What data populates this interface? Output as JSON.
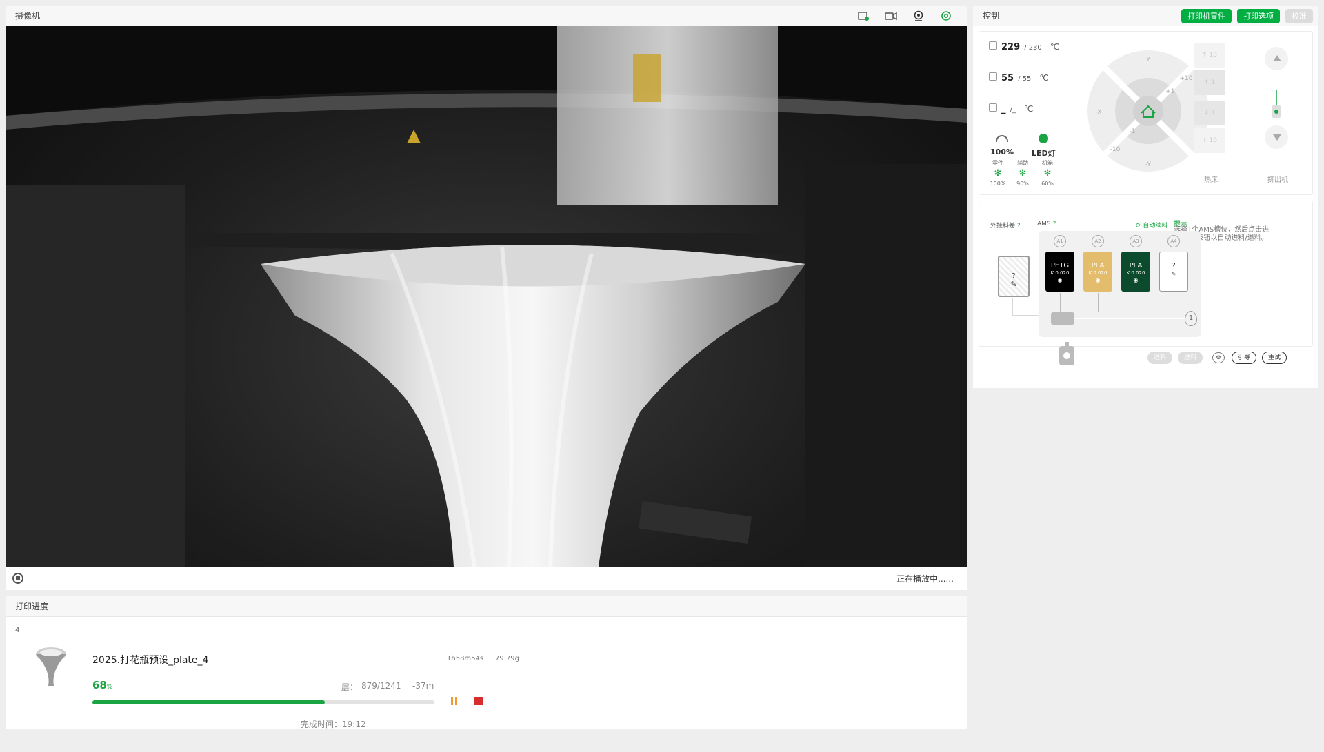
{
  "camera": {
    "title": "摄像机",
    "status": "正在播放中......",
    "header_icons": [
      "storage-icon",
      "record-icon",
      "webcam-icon",
      "settings-icon"
    ]
  },
  "progress": {
    "title": "打印进度",
    "plate_number": "4",
    "job_name": "2025.打花瓶预设_plate_4",
    "time_total": "1h58m54s",
    "weight": "79.79g",
    "percent": "68",
    "percent_unit": "%",
    "percent_value": 0.68,
    "layer_label": "层：",
    "layer_value": "879/1241",
    "remaining": "-37m",
    "finish_time": "完成时间：19:12",
    "accent": "#1aa542"
  },
  "control": {
    "title": "控制",
    "buttons": {
      "printer_parts": "打印机零件",
      "print_options": "打印选项",
      "calibrate": "校准"
    },
    "nozzle": {
      "current": "229",
      "target": "/ 230",
      "unit": "℃"
    },
    "bed": {
      "current": "55",
      "target": "/ 55",
      "unit": "℃"
    },
    "chamber": {
      "current": "_",
      "target": "/_",
      "unit": "℃"
    },
    "speed": "100%",
    "led": "LED灯",
    "fans": [
      {
        "label": "零件",
        "value": "100%"
      },
      {
        "label": "辅助",
        "value": "90%"
      },
      {
        "label": "机箱",
        "value": "60%"
      }
    ],
    "jog_labels": {
      "y": "Y",
      "neg_y": "-Y",
      "x": "X",
      "neg_x": "-X",
      "p10": "+10",
      "p1": "+1",
      "m1": "-1",
      "m10": "-10"
    },
    "z_labels": [
      "10",
      "1",
      "1",
      "10"
    ],
    "bed_label": "热床",
    "extruder_label": "挤出机"
  },
  "ams": {
    "external_spool_label": "外挂料卷",
    "ams_label": "AMS",
    "help_mark": "?",
    "auto_refill": "自动续料",
    "tip_title": "提示",
    "tip_text": "选择1个AMS槽位，然后点击进料/退料按钮以自动进料/退料。",
    "external_tray_text": "?",
    "slots": [
      {
        "id": "A1",
        "material": "PETG",
        "k": "K 0.020",
        "color": "#000000",
        "text_color": "#ffffff"
      },
      {
        "id": "A2",
        "material": "PLA",
        "k": "K 0.020",
        "color": "#e3bd6c",
        "text_color": "#ffffff"
      },
      {
        "id": "A3",
        "material": "PLA",
        "k": "K 0.020",
        "color": "#0b4a2c",
        "text_color": "#ffffff"
      },
      {
        "id": "A4",
        "material": "?",
        "k": "",
        "color": "#ffffff",
        "text_color": "#333333"
      }
    ],
    "humidity": "1",
    "buttons": {
      "unload": "退料",
      "load": "进料",
      "guide": "引导",
      "retry": "重试"
    }
  }
}
